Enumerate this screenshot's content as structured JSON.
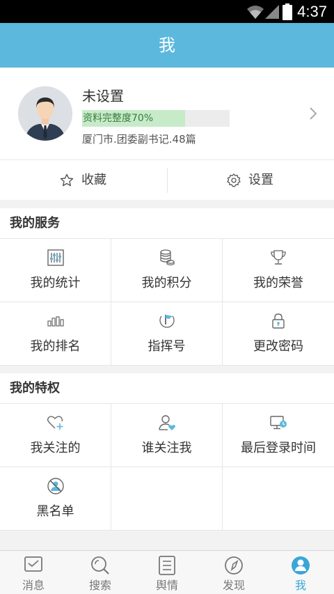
{
  "status_bar": {
    "time": "4:37",
    "icons": [
      "wifi-icon",
      "signal-icon",
      "battery-icon"
    ]
  },
  "header": {
    "title": "我"
  },
  "profile": {
    "name": "未设置",
    "completeness_text": "资料完整度70%",
    "completeness": 0.7,
    "org": "厦门市.团委副书记.48篇"
  },
  "actions": [
    {
      "label": "收藏",
      "icon": "star-icon"
    },
    {
      "label": "设置",
      "icon": "gear-icon"
    }
  ],
  "services": {
    "title": "我的服务",
    "items": [
      {
        "label": "我的统计",
        "icon": "sliders-icon"
      },
      {
        "label": "我的积分",
        "icon": "coins-icon"
      },
      {
        "label": "我的荣誉",
        "icon": "trophy-icon"
      },
      {
        "label": "我的排名",
        "icon": "bars-icon"
      },
      {
        "label": "指挥号",
        "icon": "flag-icon"
      },
      {
        "label": "更改密码",
        "icon": "lock-icon"
      }
    ]
  },
  "privileges": {
    "title": "我的特权",
    "items": [
      {
        "label": "我关注的",
        "icon": "heart-plus-icon"
      },
      {
        "label": "谁关注我",
        "icon": "user-heart-icon"
      },
      {
        "label": "最后登录时间",
        "icon": "monitor-clock-icon"
      },
      {
        "label": "黑名单",
        "icon": "blocked-user-icon"
      }
    ]
  },
  "tabbar": {
    "active": "我",
    "items": [
      {
        "label": "消息",
        "icon": "message-icon"
      },
      {
        "label": "搜索",
        "icon": "search-icon"
      },
      {
        "label": "舆情",
        "icon": "document-icon"
      },
      {
        "label": "发现",
        "icon": "compass-icon"
      },
      {
        "label": "我",
        "icon": "user-icon"
      }
    ]
  },
  "colors": {
    "primary": "#5cb8dd",
    "progress_fill": "#c7ebc9",
    "tab_active": "#3aa6d8"
  }
}
